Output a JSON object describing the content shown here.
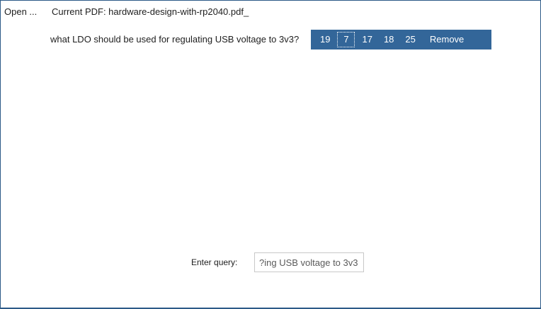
{
  "toolbar": {
    "open_label": "Open ...",
    "current_pdf_label": "Current PDF: hardware-design-with-rp2040.pdf_"
  },
  "result": {
    "question": "what LDO should be used for regulating USB voltage to 3v3?",
    "pages": [
      "19",
      "7",
      "17",
      "18",
      "25"
    ],
    "selected_page": "7",
    "remove_label": "Remove"
  },
  "query": {
    "label": "Enter query:",
    "value": "ing USB voltage to 3v3?"
  },
  "colors": {
    "accent": "#336699",
    "border": "#2c5a87"
  }
}
